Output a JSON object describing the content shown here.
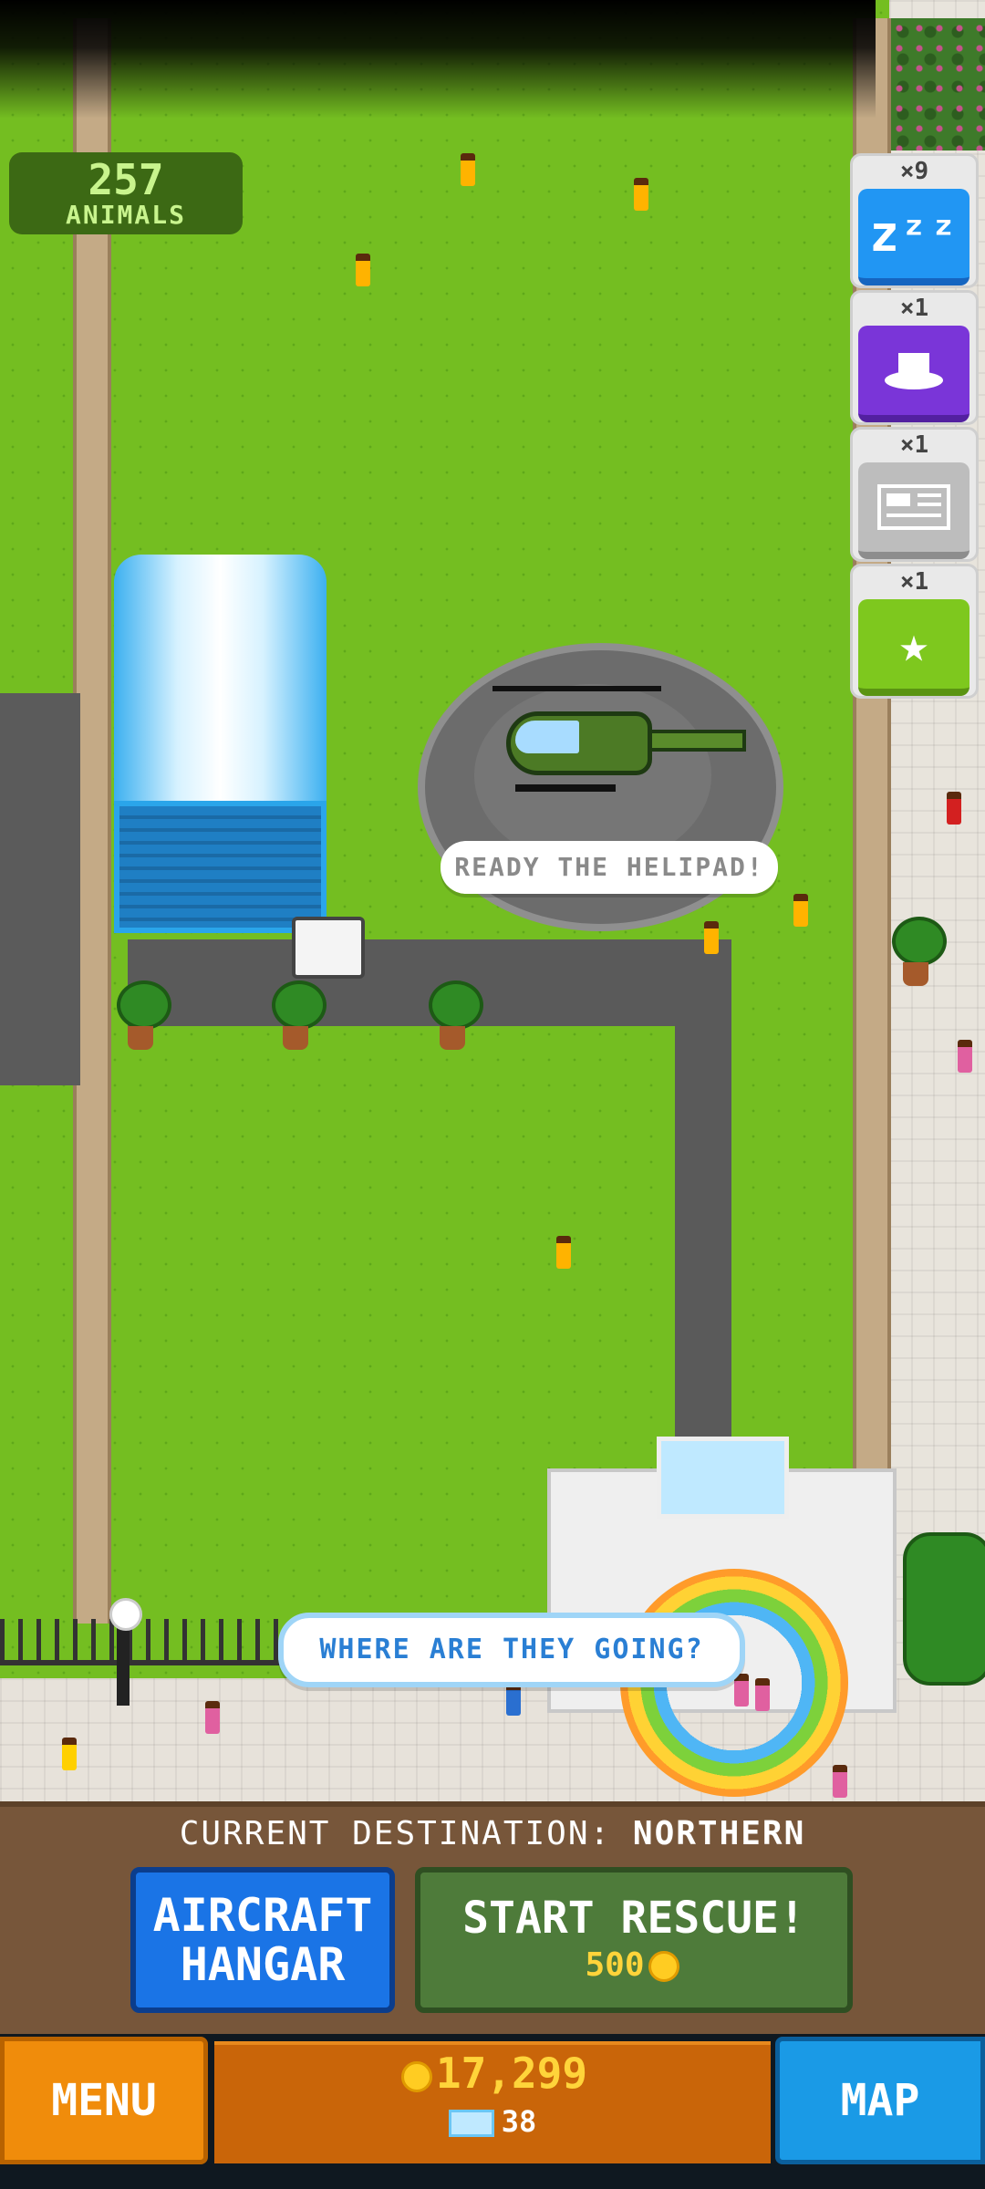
{
  "hud": {
    "animals_count": "257",
    "animals_label": "ANIMALS"
  },
  "powerups": [
    {
      "count": "×9",
      "icon": "sleep-icon",
      "glyph": "zᶻᶻ",
      "color": "#2196f3"
    },
    {
      "count": "×1",
      "icon": "hat-icon",
      "glyph": "🎩",
      "color": "#7a35d8"
    },
    {
      "count": "×1",
      "icon": "newspaper-icon",
      "glyph": "▤",
      "color": "#bdbdbd"
    },
    {
      "count": "×1",
      "icon": "star-icon",
      "glyph": "★",
      "color": "#7ec81e"
    }
  ],
  "bubbles": {
    "helipad": "READY THE HELIPAD!",
    "rainbow": "WHERE ARE THEY GOING?"
  },
  "destination": {
    "label": "CURRENT DESTINATION:",
    "value": "NORTHERN"
  },
  "buttons": {
    "hangar_line1": "AIRCRAFT",
    "hangar_line2": "HANGAR",
    "rescue_label": "START RESCUE!",
    "rescue_cost": "500",
    "menu": "MENU",
    "map": "MAP"
  },
  "currency": {
    "coins": "17,299",
    "gems": "38"
  }
}
